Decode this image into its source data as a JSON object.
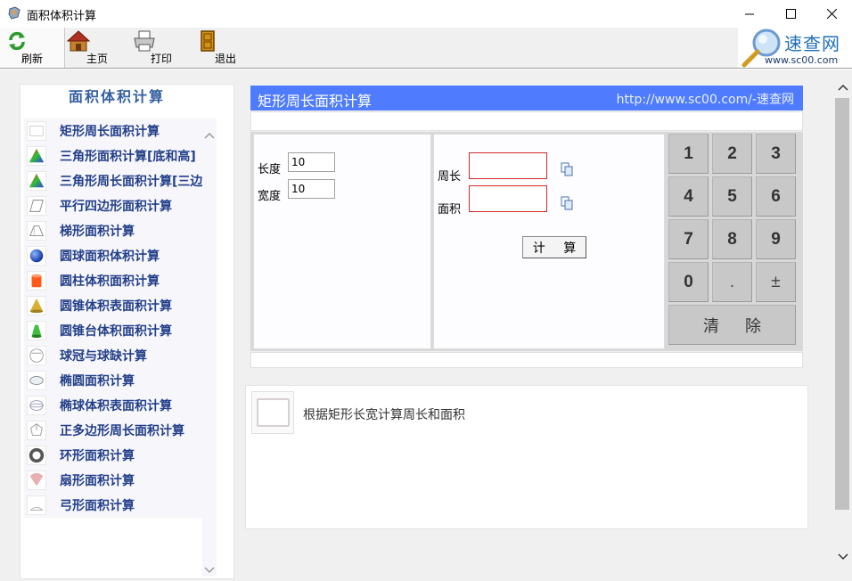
{
  "window": {
    "title": "面积体积计算"
  },
  "toolbar": {
    "refresh": "刷新",
    "home": "主页",
    "print": "打印",
    "exit": "退出"
  },
  "brand": {
    "name": "速查网",
    "url": "www.sc00.com"
  },
  "sidebar": {
    "title": "面积体积计算",
    "items": [
      {
        "label": "矩形周长面积计算"
      },
      {
        "label": "三角形面积计算[底和高]"
      },
      {
        "label": "三角形周长面积计算[三边]"
      },
      {
        "label": "平行四边形面积计算"
      },
      {
        "label": "梯形面积计算"
      },
      {
        "label": "圆球面积体积计算"
      },
      {
        "label": "圆柱体积面积计算"
      },
      {
        "label": "圆锥体积表面积计算"
      },
      {
        "label": "圆锥台体积面积计算"
      },
      {
        "label": "球冠与球缺计算"
      },
      {
        "label": "椭圆面积计算"
      },
      {
        "label": "椭球体积表面积计算"
      },
      {
        "label": "正多边形周长面积计算"
      },
      {
        "label": "环形面积计算"
      },
      {
        "label": "扇形面积计算"
      },
      {
        "label": "弓形面积计算"
      }
    ]
  },
  "content": {
    "title": "矩形周长面积计算",
    "site": "http://www.sc00.com/-速查网",
    "length_label": "长度",
    "length_value": "10",
    "width_label": "宽度",
    "width_value": "10",
    "perimeter_label": "周长",
    "area_label": "面积",
    "calc_button": "计 算",
    "description": "根据矩形长宽计算周长和面积"
  },
  "keypad": {
    "keys": [
      "1",
      "2",
      "3",
      "4",
      "5",
      "6",
      "7",
      "8",
      "9",
      "0",
      ".",
      "±"
    ],
    "clear": "清 除"
  },
  "colors": {
    "header_bg": "#4f7cff",
    "sidebar_link": "#233f8a",
    "output_border": "#d42a2a"
  }
}
